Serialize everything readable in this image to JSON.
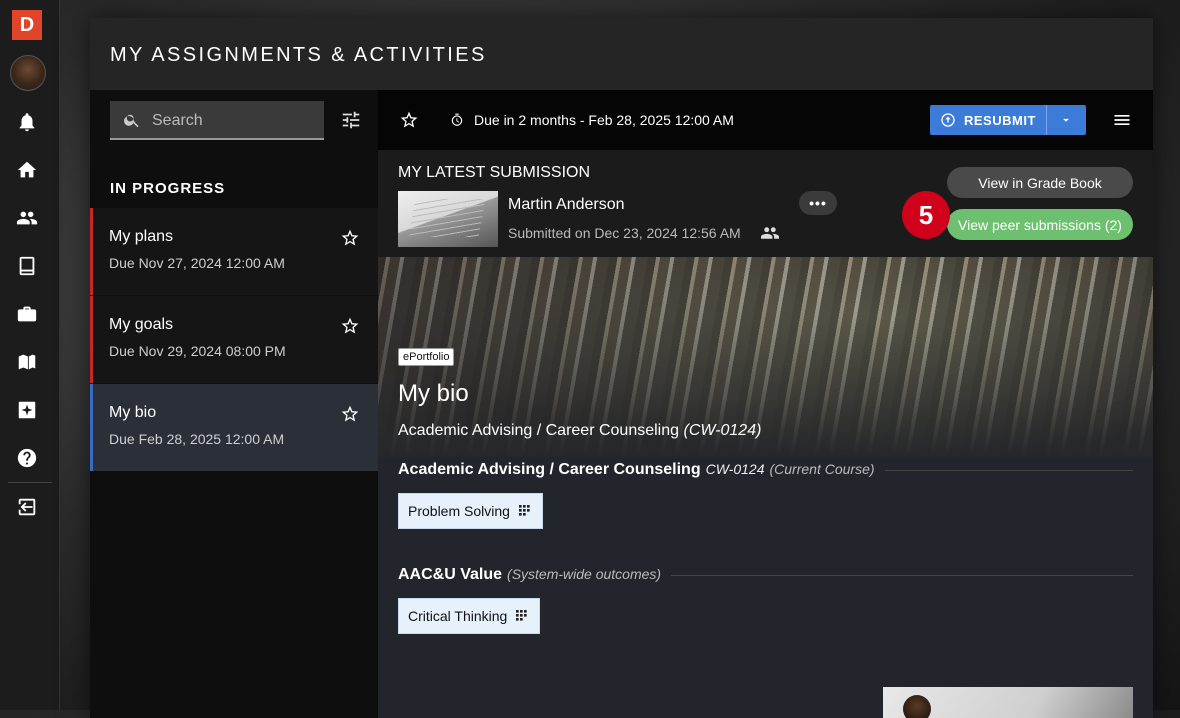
{
  "app": {
    "logo_letter": "D"
  },
  "rail": {
    "items": [
      {
        "name": "notifications",
        "icon": "bell-icon"
      },
      {
        "name": "home",
        "icon": "home-icon"
      },
      {
        "name": "people",
        "icon": "people-icon"
      },
      {
        "name": "library",
        "icon": "book-icon"
      },
      {
        "name": "portfolio",
        "icon": "briefcase-icon"
      },
      {
        "name": "courses",
        "icon": "books-icon"
      },
      {
        "name": "ai-assistant",
        "icon": "sparkle-icon"
      },
      {
        "name": "help",
        "icon": "help-icon"
      },
      {
        "name": "logout",
        "icon": "exit-icon"
      }
    ]
  },
  "modal": {
    "title": "MY ASSIGNMENTS & ACTIVITIES"
  },
  "search": {
    "placeholder": "Search",
    "value": ""
  },
  "list": {
    "heading": "IN PROGRESS",
    "items": [
      {
        "title": "My plans",
        "due": "Due Nov 27, 2024 12:00 AM"
      },
      {
        "title": "My goals",
        "due": "Due Nov 29, 2024 08:00 PM"
      },
      {
        "title": "My bio",
        "due": "Due Feb 28, 2025 12:00 AM"
      }
    ],
    "selected_index": 2
  },
  "toolbar": {
    "due_text": "Due in 2 months - Feb 28, 2025 12:00 AM",
    "resubmit_label": "RESUBMIT"
  },
  "submission": {
    "label": "MY LATEST SUBMISSION",
    "author": "Martin Anderson",
    "submitted": "Submitted on Dec 23, 2024 12:56 AM",
    "more_label": "•••",
    "step_badge": "5",
    "gradebook_label": "View in Grade Book",
    "peer_label": "View peer submissions (2)"
  },
  "detail": {
    "tag": "ePortfolio",
    "title": "My bio",
    "course_name": "Academic Advising / Career Counseling",
    "course_code": "(CW-0124)",
    "outcomes": [
      {
        "heading": "Academic Advising / Career Counseling",
        "code": "CW-0124",
        "note": "(Current Course)",
        "chip": "Problem Solving"
      },
      {
        "heading": "AAC&U Value",
        "code": "",
        "note": "(System-wide outcomes)",
        "chip": "Critical Thinking"
      }
    ]
  },
  "colors": {
    "accent_blue": "#3d7bd9",
    "peer_green": "#6cc070",
    "badge_red": "#d0021b",
    "in_progress_red": "#c62828",
    "brand_orange": "#e0452b"
  }
}
